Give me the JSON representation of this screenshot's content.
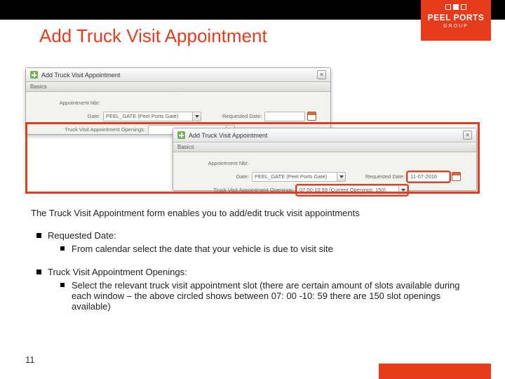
{
  "brand": {
    "line1": "PEEL PORTS",
    "line2": "GROUP"
  },
  "title": "Add Truck Visit Appointment",
  "dialog": {
    "window_title": "Add Truck Visit Appointment",
    "section_label": "Basics",
    "labels": {
      "appointment_nbr": "Appointment Nbr:",
      "gate": "Gate:",
      "requested_date": "Requested Date:",
      "openings": "Truck Visit Appointment Openings:"
    },
    "fields": {
      "gate_value": "PEEL_GATE (Peel Ports Gate)",
      "requested_date_value": "11-07-2016",
      "openings_value": "07:00-10:59 (Current Openings: 150)"
    }
  },
  "intro": "The Truck Visit Appointment form enables you to add/edit truck visit appointments",
  "bullets": {
    "b1_label": "Requested Date:",
    "b1_sub": "From calendar select the date that your vehicle is due to visit site",
    "b2_label": "Truck Visit Appointment Openings:",
    "b2_sub": "Select the relevant truck visit appointment slot (there are certain amount of slots available during each window – the above circled shows between 07: 00 -10: 59 there are 150 slot openings available)"
  },
  "page_number": "11"
}
